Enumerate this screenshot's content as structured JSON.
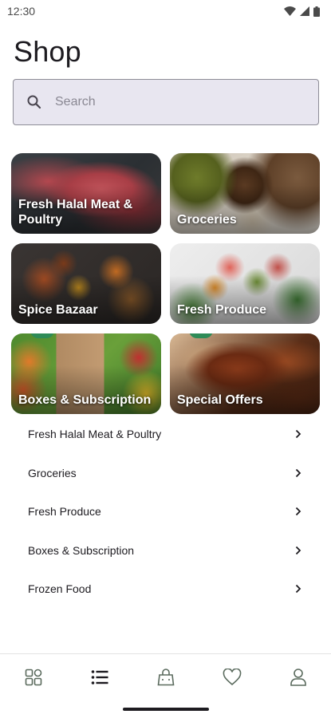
{
  "status_bar": {
    "time": "12:30"
  },
  "page": {
    "title": "Shop"
  },
  "search": {
    "placeholder": "Search",
    "icon": "search-icon"
  },
  "tiles": [
    {
      "label": "Fresh Halal Meat & Poultry",
      "image": "raw-meat-photo"
    },
    {
      "label": "Groceries",
      "image": "grains-and-nuts-photo"
    },
    {
      "label": "Spice Bazaar",
      "image": "spices-photo"
    },
    {
      "label": "Fresh Produce",
      "image": "fresh-fruit-and-vegetables-photo"
    },
    {
      "label": "Boxes & Subscription",
      "image": "produce-box-photo"
    },
    {
      "label": "Special Offers",
      "image": "grilled-wings-photo"
    }
  ],
  "list": [
    {
      "label": "Fresh Halal Meat & Poultry"
    },
    {
      "label": "Groceries"
    },
    {
      "label": "Fresh Produce"
    },
    {
      "label": "Boxes & Subscription"
    },
    {
      "label": "Frozen Food"
    }
  ],
  "nav": {
    "items": [
      {
        "icon": "grid-icon"
      },
      {
        "icon": "list-icon",
        "active": true
      },
      {
        "icon": "bag-icon"
      },
      {
        "icon": "heart-icon"
      },
      {
        "icon": "person-icon"
      }
    ]
  },
  "colors": {
    "accent_green": "#2e8b57",
    "search_bg": "#e8e6f0",
    "text_primary": "#1d1b20"
  }
}
